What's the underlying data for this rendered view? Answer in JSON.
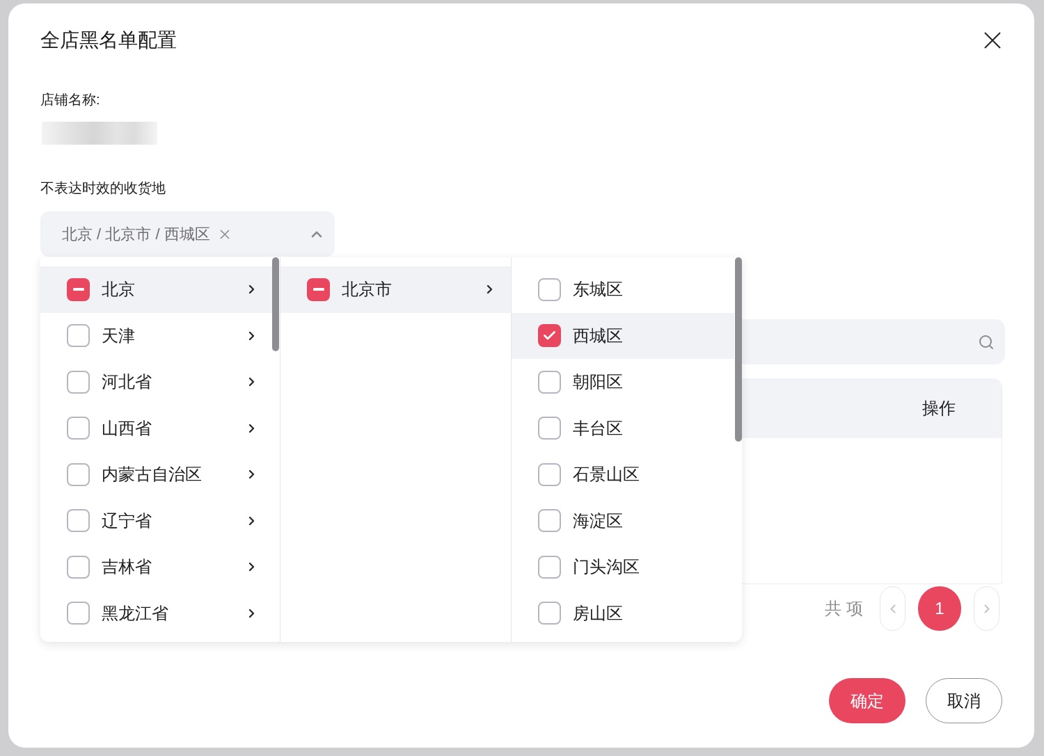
{
  "dialog": {
    "title": "全店黑名单配置"
  },
  "store": {
    "label": "店铺名称:"
  },
  "delivery_area": {
    "label": "不表达时效的收货地",
    "cascader": {
      "value": "北京 / 北京市 / 西城区",
      "expanded": true,
      "columns": [
        {
          "scrollable": true,
          "items": [
            {
              "label": "北京",
              "kind": "branch",
              "selected": true,
              "checked": true,
              "indeterminate": true
            },
            {
              "label": "天津",
              "kind": "branch",
              "selected": false,
              "checked": false,
              "indeterminate": false
            },
            {
              "label": "河北省",
              "kind": "branch",
              "selected": false,
              "checked": false,
              "indeterminate": false
            },
            {
              "label": "山西省",
              "kind": "branch",
              "selected": false,
              "checked": false,
              "indeterminate": false
            },
            {
              "label": "内蒙古自治区",
              "kind": "branch",
              "selected": false,
              "checked": false,
              "indeterminate": false
            },
            {
              "label": "辽宁省",
              "kind": "branch",
              "selected": false,
              "checked": false,
              "indeterminate": false
            },
            {
              "label": "吉林省",
              "kind": "branch",
              "selected": false,
              "checked": false,
              "indeterminate": false
            },
            {
              "label": "黑龙江省",
              "kind": "branch",
              "selected": false,
              "checked": false,
              "indeterminate": false
            }
          ]
        },
        {
          "scrollable": false,
          "items": [
            {
              "label": "北京市",
              "kind": "branch",
              "selected": true,
              "checked": true,
              "indeterminate": true
            }
          ]
        },
        {
          "scrollable": true,
          "items": [
            {
              "label": "东城区",
              "kind": "leaf",
              "selected": false,
              "checked": false,
              "indeterminate": false
            },
            {
              "label": "西城区",
              "kind": "leaf",
              "selected": true,
              "checked": true,
              "indeterminate": false
            },
            {
              "label": "朝阳区",
              "kind": "leaf",
              "selected": false,
              "checked": false,
              "indeterminate": false
            },
            {
              "label": "丰台区",
              "kind": "leaf",
              "selected": false,
              "checked": false,
              "indeterminate": false
            },
            {
              "label": "石景山区",
              "kind": "leaf",
              "selected": false,
              "checked": false,
              "indeterminate": false
            },
            {
              "label": "海淀区",
              "kind": "leaf",
              "selected": false,
              "checked": false,
              "indeterminate": false
            },
            {
              "label": "门头沟区",
              "kind": "leaf",
              "selected": false,
              "checked": false,
              "indeterminate": false
            },
            {
              "label": "房山区",
              "kind": "leaf",
              "selected": false,
              "checked": false,
              "indeterminate": false
            }
          ]
        }
      ]
    }
  },
  "table": {
    "columns": [
      "操作"
    ]
  },
  "pagination": {
    "total": "共 项",
    "prev": {
      "disabled": true
    },
    "next": {
      "disabled": true
    },
    "pages": [
      {
        "label": "1",
        "selected": true
      }
    ]
  },
  "buttons": [
    {
      "label": "确定",
      "kind": "primary"
    },
    {
      "label": "取消",
      "kind": "secondary"
    }
  ]
}
